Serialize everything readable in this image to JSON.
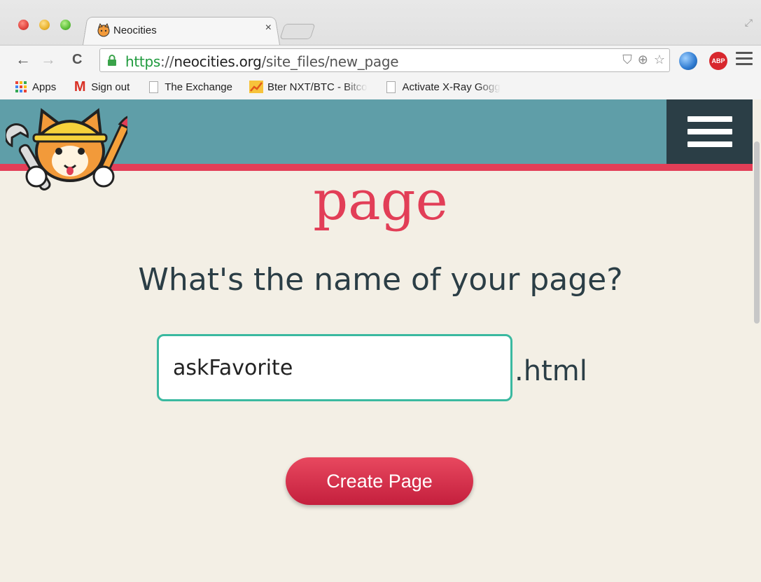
{
  "browser": {
    "tab_title": "Neocities",
    "tab_close": "×",
    "url_scheme": "https",
    "url_sep": "://",
    "url_host": "neocities.org",
    "url_path": "/site_files/new_page",
    "nav": {
      "back": "←",
      "forward": "→",
      "reload": "C"
    },
    "abp_label": "ABP",
    "bookmarks": [
      {
        "label": "Apps",
        "icon": "apps-grid-icon"
      },
      {
        "label": "Sign out",
        "icon": "gmail-icon"
      },
      {
        "label": "The Exchange",
        "icon": "document-icon"
      },
      {
        "label": "Bter NXT/BTC - Bitco",
        "icon": "chart-trend-icon"
      },
      {
        "label": "Activate X-Ray Gogg",
        "icon": "document-icon"
      }
    ]
  },
  "page": {
    "heading": "page",
    "question": "What's the name of your page?",
    "input_value": "askFavorite",
    "extension": ".html",
    "create_button": "Create Page"
  },
  "colors": {
    "banner": "#5f9ea8",
    "accent": "#e23e57",
    "input_border": "#3ab9a0",
    "dark": "#2b3e46",
    "background": "#f3efe5"
  }
}
